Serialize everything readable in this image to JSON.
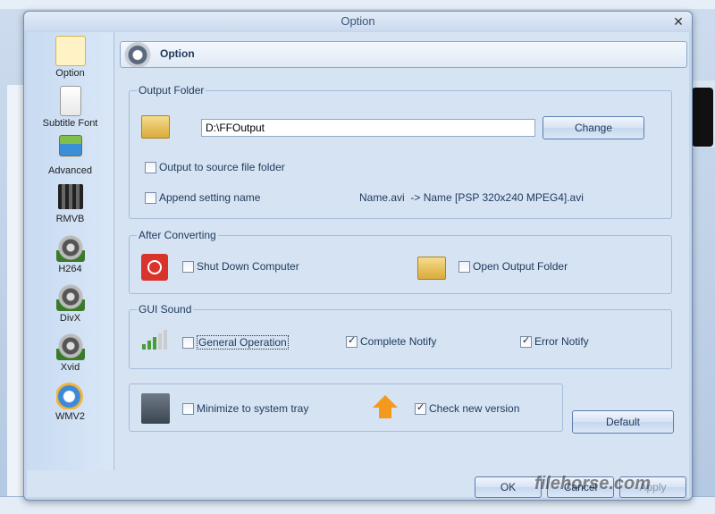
{
  "window": {
    "title": "Option",
    "close_label": "✕"
  },
  "sidebar": {
    "items": [
      {
        "label": "Option",
        "icon": "camera-icon",
        "active": true
      },
      {
        "label": "Subtitle Font",
        "icon": "document-icon"
      },
      {
        "label": "Advanced",
        "icon": "picture-icon"
      },
      {
        "label": "RMVB",
        "icon": "clapper-icon"
      },
      {
        "label": "H264",
        "icon": "film-reel-icon"
      },
      {
        "label": "DivX",
        "icon": "film-reel-icon"
      },
      {
        "label": "Xvid",
        "icon": "film-reel-icon"
      },
      {
        "label": "WMV2",
        "icon": "media-player-icon"
      }
    ]
  },
  "header": {
    "title": "Option"
  },
  "output_folder": {
    "title": "Output Folder",
    "path": "D:\\FFOutput",
    "change_label": "Change",
    "output_to_source_label": "Output to source file folder",
    "output_to_source_checked": false,
    "append_setting_label": "Append setting name",
    "append_setting_checked": false,
    "name_example": "Name.avi  -> Name [PSP 320x240 MPEG4].avi"
  },
  "after_converting": {
    "title": "After Converting",
    "shutdown_label": "Shut Down Computer",
    "shutdown_checked": false,
    "open_folder_label": "Open Output Folder",
    "open_folder_checked": false
  },
  "gui_sound": {
    "title": "GUI Sound",
    "general_label": "General Operation",
    "general_checked": false,
    "complete_label": "Complete Notify",
    "complete_checked": true,
    "error_label": "Error Notify",
    "error_checked": true
  },
  "misc": {
    "minimize_label": "Minimize to system tray",
    "minimize_checked": false,
    "check_version_label": "Check new version",
    "check_version_checked": true,
    "default_label": "Default"
  },
  "footer": {
    "ok_label": "OK",
    "cancel_label": "Cancel",
    "apply_label": "Apply"
  },
  "watermark": "filehorse.com"
}
